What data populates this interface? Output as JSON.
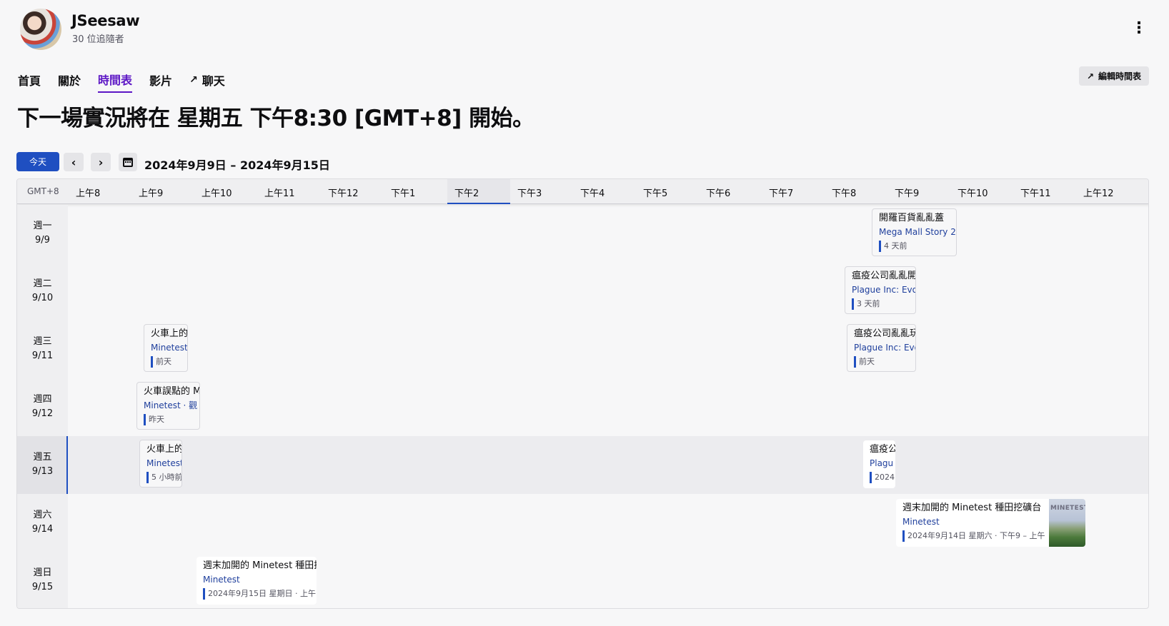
{
  "channel": {
    "name": "JSeesaw",
    "followers": "30 位追隨者"
  },
  "tabs": [
    {
      "label": "首頁"
    },
    {
      "label": "關於"
    },
    {
      "label": "時間表"
    },
    {
      "label": "影片"
    },
    {
      "label": "聊天"
    }
  ],
  "edit_schedule_label": "編輯時間表",
  "headline": "下一場實況將在 星期五 下午8:30 [GMT+8] 開始。",
  "toolbar": {
    "today_label": "今天",
    "prev_icon": "chevron-left-icon",
    "next_icon": "chevron-right-icon",
    "calendar_icon": "calendar-icon",
    "date_range": "2024年9月9日 – 2024年9月15日"
  },
  "calendar": {
    "timezone": "GMT+8",
    "hours": [
      "上午8",
      "上午9",
      "上午10",
      "上午11",
      "下午12",
      "下午1",
      "下午2",
      "下午3",
      "下午4",
      "下午5",
      "下午6",
      "下午7",
      "下午8",
      "下午9",
      "下午10",
      "下午11",
      "上午12"
    ],
    "current_hour": "下午2",
    "days": [
      {
        "name": "週一",
        "date": "9/9"
      },
      {
        "name": "週二",
        "date": "9/10"
      },
      {
        "name": "週三",
        "date": "9/11"
      },
      {
        "name": "週四",
        "date": "9/12"
      },
      {
        "name": "週五",
        "date": "9/13"
      },
      {
        "name": "週六",
        "date": "9/14"
      },
      {
        "name": "週日",
        "date": "9/15"
      }
    ],
    "events": [
      {
        "title": "開羅百貨亂亂蓋",
        "game": "Mega Mall Story 2",
        "time": "4 天前"
      },
      {
        "title": "瘟疫公司亂亂開",
        "game": "Plague Inc: Evol",
        "time": "3 天前"
      },
      {
        "title": "火車上的",
        "game": "Minetest",
        "time": "前天"
      },
      {
        "title": "瘟疫公司亂亂玩",
        "game": "Plague Inc: Evo",
        "time": "前天"
      },
      {
        "title": "火車誤點的 M",
        "game": "Minetest · 觀",
        "time": "昨天"
      },
      {
        "title": "火車上的",
        "game": "Minetest",
        "time": "5 小時前"
      },
      {
        "title": "瘟疫公",
        "game": "Plagu",
        "time": "2024"
      },
      {
        "title": "週末加開的 Minetest 種田挖礦台",
        "game": "Minetest",
        "time": "2024年9月14日 星期六 · 下午9 – 上午",
        "thumb_text": "MINETEST"
      },
      {
        "title": "週末加開的 Minetest 種田挖",
        "game": "Minetest",
        "time": "2024年9月15日 星期日 · 上午"
      }
    ]
  }
}
